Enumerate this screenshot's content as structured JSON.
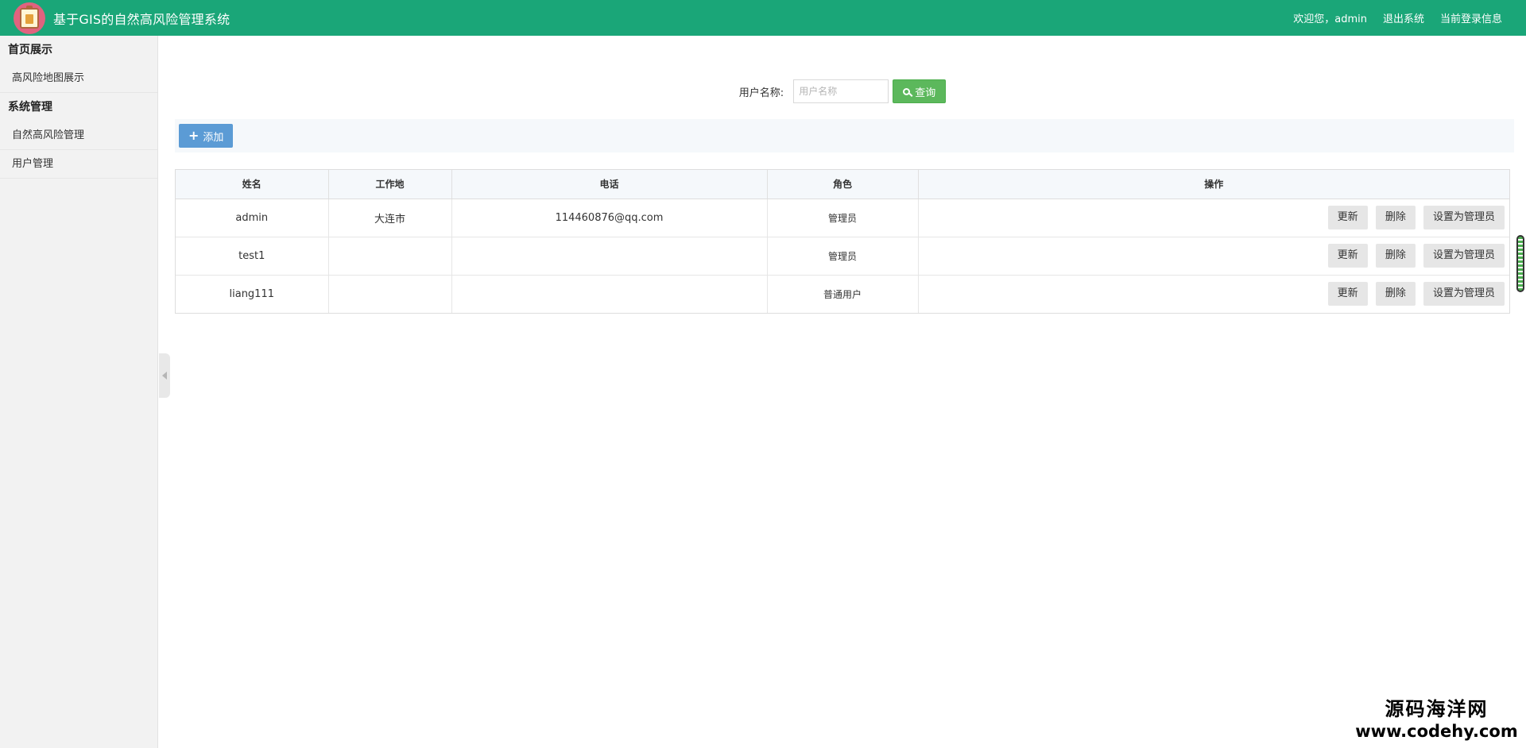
{
  "header": {
    "title": "基于GIS的自然高风险管理系统",
    "welcome": "欢迎您，admin",
    "logout": "退出系统",
    "login_info": "当前登录信息",
    "color": "#1aa678"
  },
  "sidebar": {
    "sections": [
      {
        "title": "首页展示",
        "items": [
          "高风险地图展示"
        ]
      },
      {
        "title": "系统管理",
        "items": [
          "自然高风险管理",
          "用户管理"
        ]
      }
    ]
  },
  "search": {
    "label": "用户名称:",
    "placeholder": "用户名称",
    "value": "",
    "button_label": "查询"
  },
  "toolbar": {
    "add_label": "添加"
  },
  "table": {
    "columns": [
      "姓名",
      "工作地",
      "电话",
      "角色",
      "操作"
    ],
    "rows": [
      {
        "name": "admin",
        "workplace": "大连市",
        "phone": "114460876@qq.com",
        "role": "管理员"
      },
      {
        "name": "test1",
        "workplace": "",
        "phone": "",
        "role": "管理员"
      },
      {
        "name": "liang111",
        "workplace": "",
        "phone": "",
        "role": "普通用户"
      }
    ],
    "actions": [
      "更新",
      "删除",
      "设置为管理员"
    ]
  },
  "watermark": {
    "name": "源码海洋网",
    "url": "www.codehy.com"
  }
}
